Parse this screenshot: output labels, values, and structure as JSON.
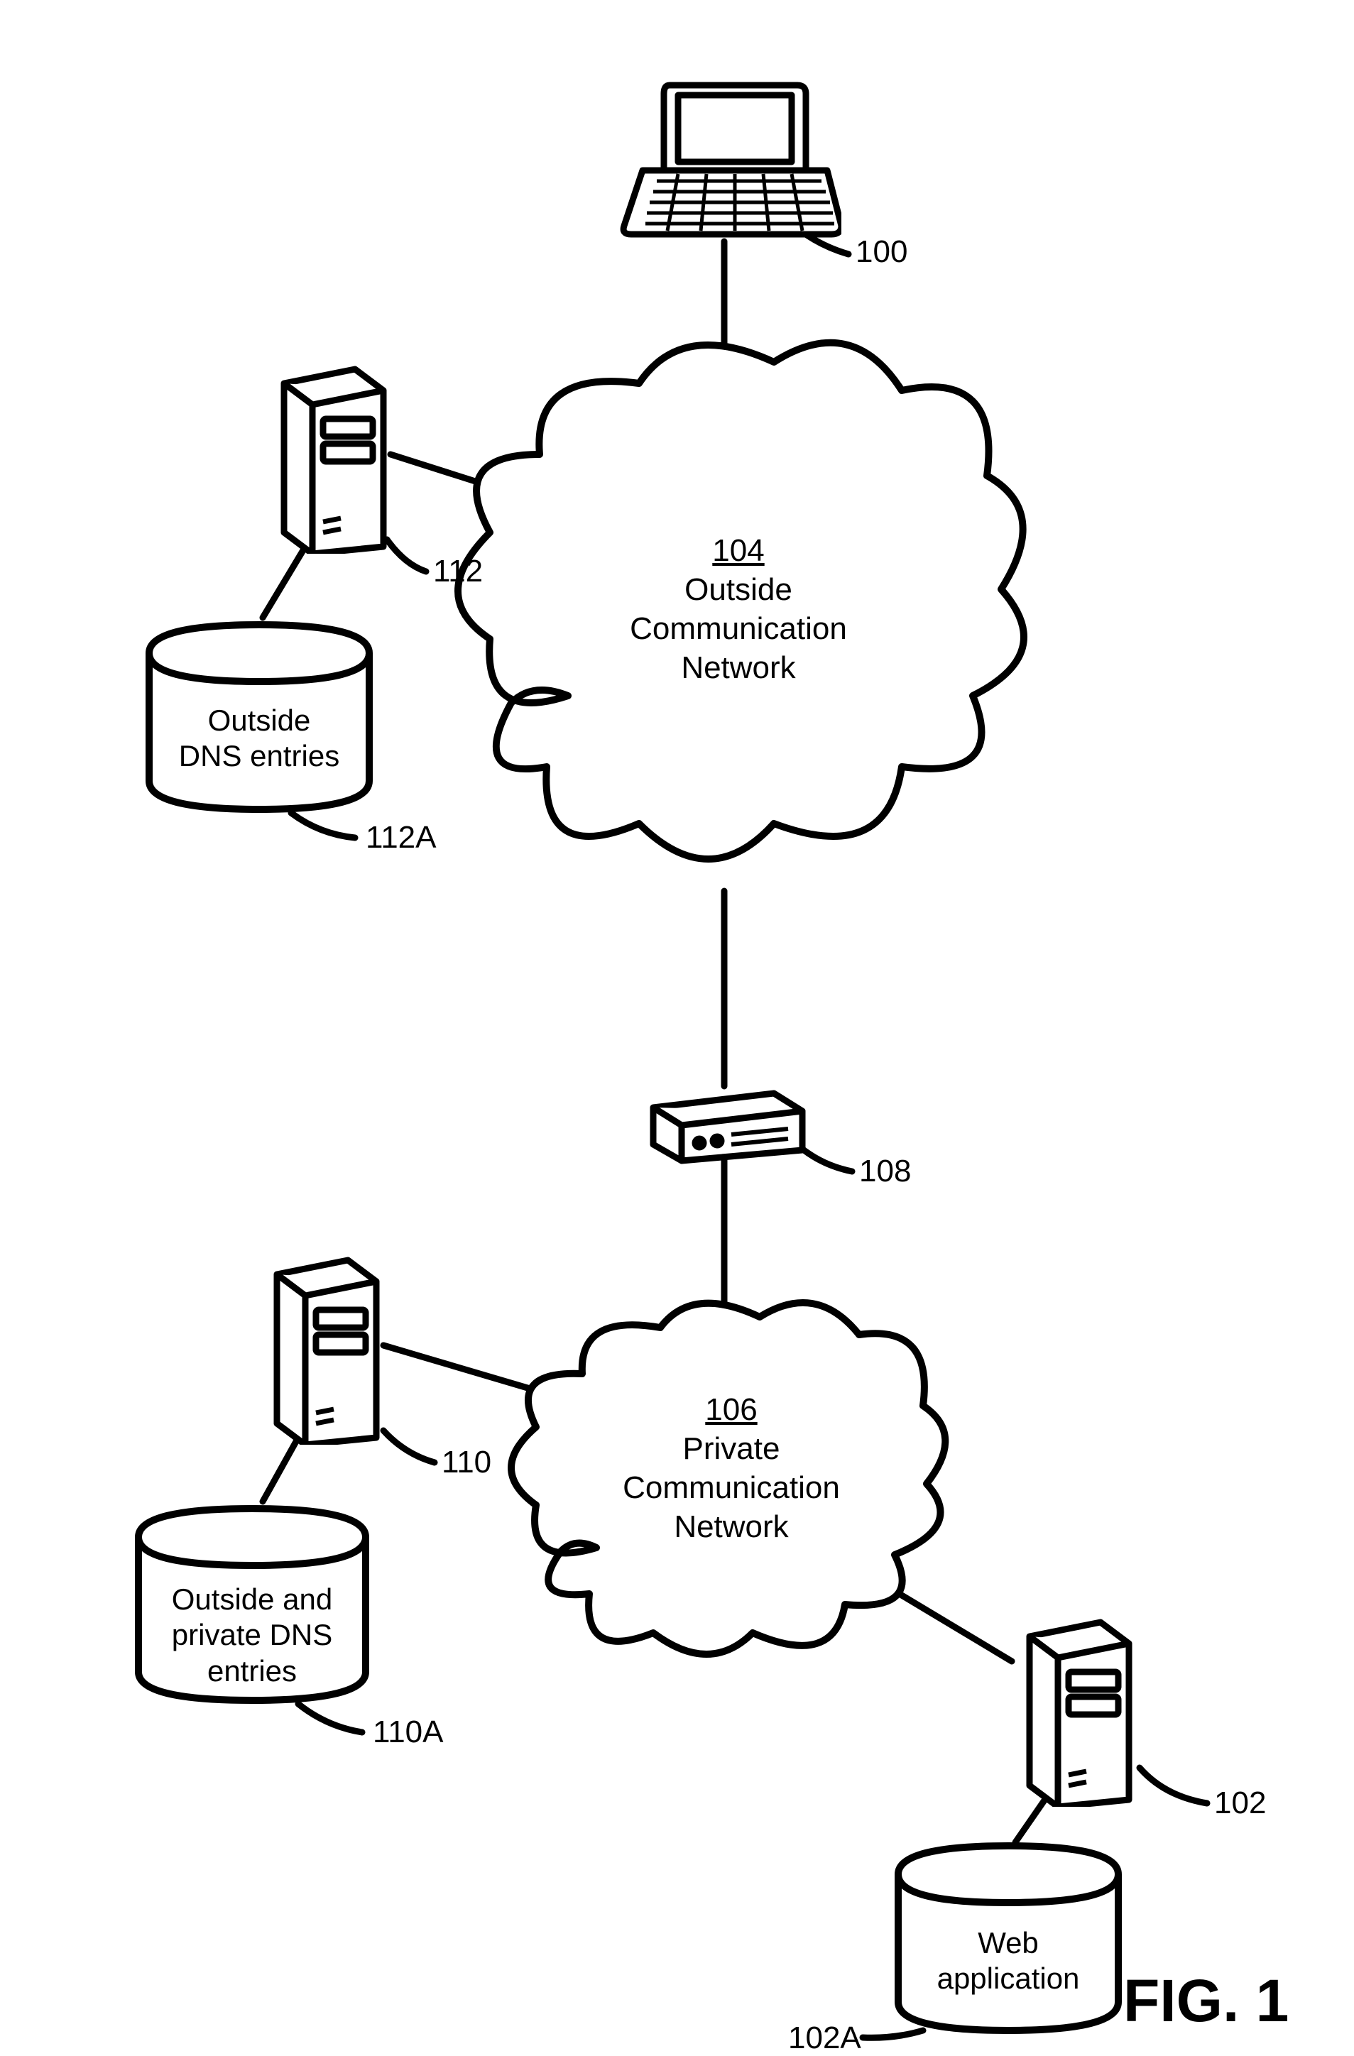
{
  "figure_label": "FIG. 1",
  "refs": {
    "laptop": "100",
    "web_server": "102",
    "web_app_db": "102A",
    "outside_cloud_num": "104",
    "private_cloud_num": "106",
    "firewall": "108",
    "private_dns_server": "110",
    "private_dns_db": "110A",
    "outside_dns_server": "112",
    "outside_dns_db": "112A"
  },
  "text": {
    "outside_cloud_l1": "Outside",
    "outside_cloud_l2": "Communication",
    "outside_cloud_l3": "Network",
    "private_cloud_l1": "Private",
    "private_cloud_l2": "Communication",
    "private_cloud_l3": "Network",
    "outside_dns_l1": "Outside",
    "outside_dns_l2": "DNS entries",
    "private_dns_l1": "Outside and",
    "private_dns_l2": "private DNS",
    "private_dns_l3": "entries",
    "web_app_l1": "Web",
    "web_app_l2": "application"
  }
}
